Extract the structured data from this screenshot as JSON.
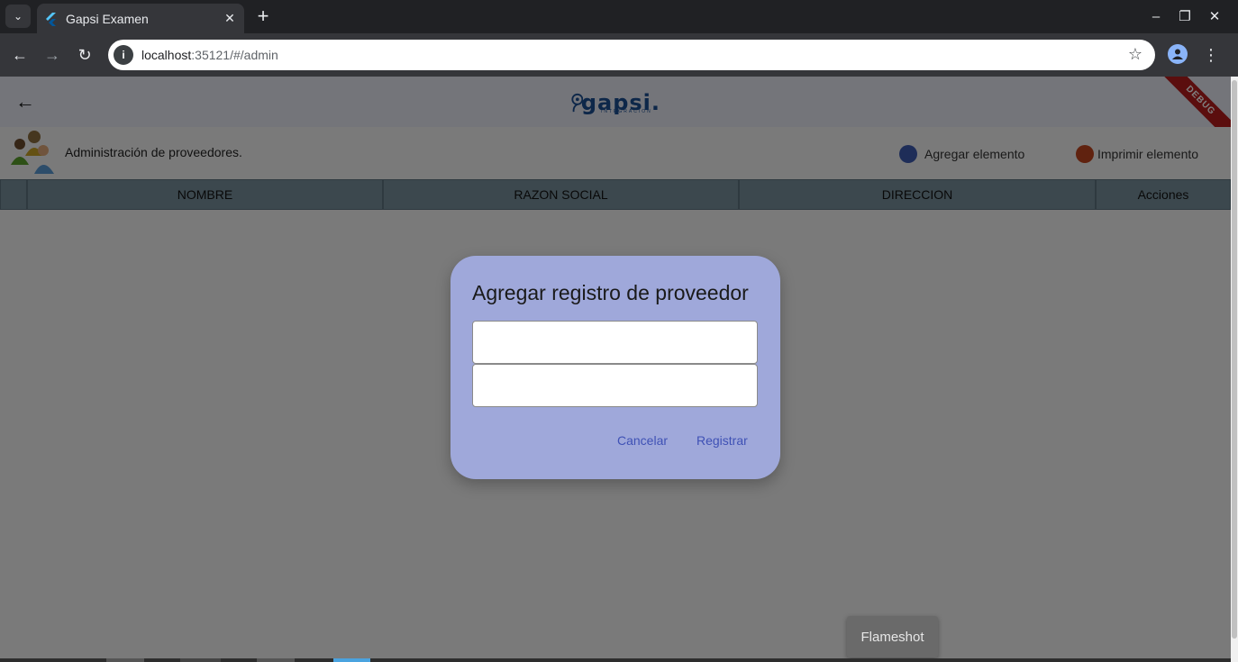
{
  "browser": {
    "tab_title": "Gapsi Examen",
    "url_host": "localhost",
    "url_rest": ":35121/#/admin"
  },
  "app": {
    "logo_text": "gapsi.",
    "logo_tagline": "INTEGRACION",
    "debug_banner": "DEBUG",
    "section_title": "Administración de proveedores.",
    "actions": [
      {
        "label": "Agregar elemento",
        "color": "#3d5ab0"
      },
      {
        "label": "Imprimir elemento",
        "color": "#c0441e"
      }
    ],
    "table": {
      "columns": [
        "",
        "NOMBRE",
        "RAZON SOCIAL",
        "DIRECCION",
        "Acciones"
      ]
    }
  },
  "dialog": {
    "title": "Agregar registro de proveedor",
    "field1_value": "",
    "field2_value": "",
    "cancel_label": "Cancelar",
    "submit_label": "Registrar"
  },
  "overlay_app": {
    "flameshot_label": "Flameshot"
  },
  "colors": {
    "dialog_bg": "#9fa8da",
    "table_header_bg": "#78909c",
    "brand_blue": "#1b4f92"
  }
}
